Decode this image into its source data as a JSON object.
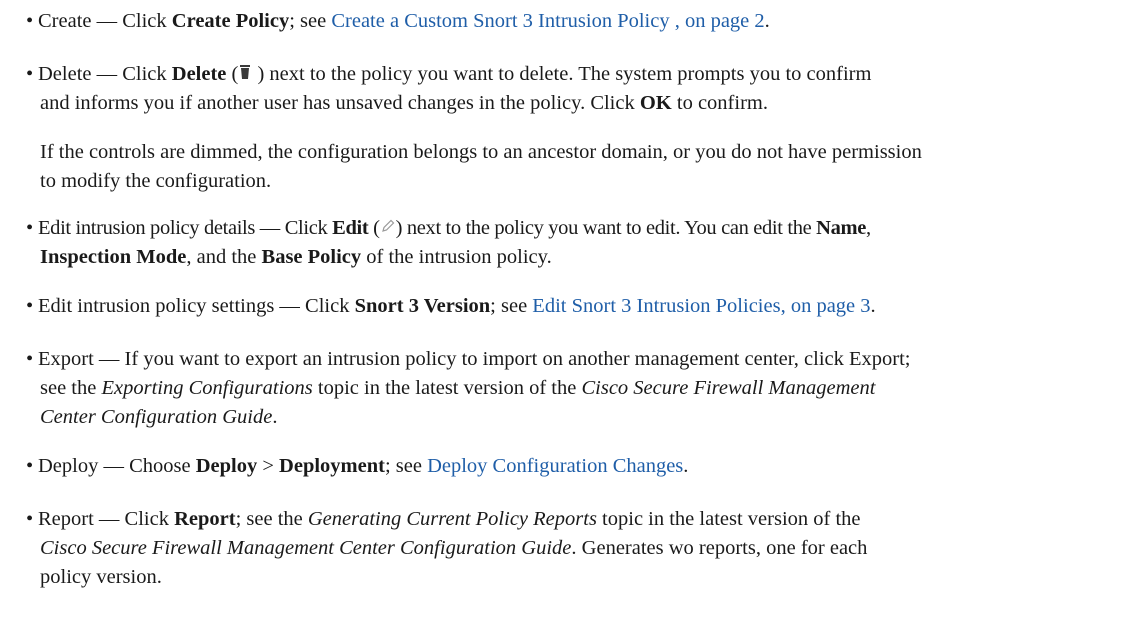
{
  "items": {
    "create": {
      "lead": "Create — Click ",
      "bold": "Create Policy",
      "mid": "; see ",
      "link": "Create a Custom Snort 3 Intrusion Policy , on page 2",
      "end": "."
    },
    "delete": {
      "lead": "Delete — Click ",
      "bold": "Delete",
      "open": " (",
      "close": " ) next to the policy you want to delete. The system prompts you to confirm",
      "line2a": "and informs you if another user has unsaved changes in the policy. Click ",
      "ok": "OK",
      "line2b": " to confirm."
    },
    "dimmed_note": {
      "line1": "If the controls are dimmed, the configuration belongs to an ancestor domain, or you do not have permission",
      "line2": "to modify the configuration."
    },
    "edit_details": {
      "lead": "Edit intrusion policy details — Click ",
      "bold": "Edit",
      "open": " (",
      "close": ") next to the policy you want to edit. You can edit the ",
      "name": "Name",
      "comma": ",",
      "inspection": "Inspection Mode",
      "and_the": ", and the ",
      "base": "Base Policy",
      "end": " of the intrusion policy."
    },
    "edit_settings": {
      "lead": "Edit intrusion policy settings — Click ",
      "bold": "Snort 3 Version",
      "mid": "; see ",
      "link": "Edit Snort 3 Intrusion Policies, on page 3",
      "end": "."
    },
    "export": {
      "lead": "Export — If you want to export an intrusion policy to import on another management center, click Export;",
      "line2a": "see the ",
      "topic": "Exporting Configurations",
      "line2b": " topic in the latest version of the ",
      "guide1": "Cisco Secure Firewall Management",
      "guide2": "Center Configuration Guide",
      "end": "."
    },
    "deploy": {
      "lead": "Deploy — Choose ",
      "bold1": "Deploy",
      "sep": " > ",
      "bold2": "Deployment",
      "mid": "; see ",
      "link": "Deploy Configuration Changes",
      "end": "."
    },
    "report": {
      "lead": "Report — Click ",
      "bold": "Report",
      "mid": "; see the ",
      "topic": "Generating Current Policy Reports",
      "mid2": " topic in the latest version of the",
      "guide": "Cisco Secure Firewall Management Center Configuration Guide",
      "after": ". Generates wo reports, one for each",
      "line3": "policy version."
    }
  },
  "colors": {
    "link": "#1f5ea8",
    "text": "#1a1a1a"
  },
  "icons": {
    "delete": "trash-icon",
    "edit": "pencil-icon"
  }
}
